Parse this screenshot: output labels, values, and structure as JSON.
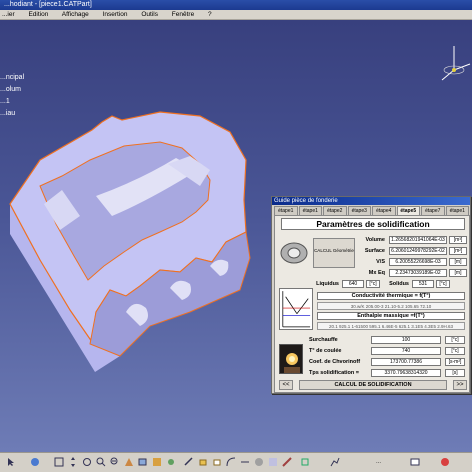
{
  "window": {
    "title": "...hodiant - [piece1.CATPart]"
  },
  "menu": [
    "...ier",
    "Edition",
    "Affichage",
    "Insertion",
    "Outils",
    "Fenêtre",
    "?"
  ],
  "tree": [
    "...ncipal",
    "...olum",
    "...1",
    "...iau"
  ],
  "dialog": {
    "title": "Guide pièce de fonderie",
    "tabs": [
      "étape1",
      "étape1",
      "étape2",
      "étape3",
      "étape4",
      "étape5",
      "étape7",
      "étape1"
    ],
    "active_tab": 5,
    "panel_title": "Paramètres de solidification",
    "calc_button": "CALCUL Géométrie",
    "fields": [
      {
        "label": "Volume",
        "value": "1.26568201941064E-03",
        "unit": "[m³]"
      },
      {
        "label": "Surface",
        "value": "6.20601249978292E-02",
        "unit": "[m²]"
      },
      {
        "label": "V/S",
        "value": "6.20055226698E-03",
        "unit": "[m]"
      },
      {
        "label": "Mx Eq",
        "value": "2.23473039189E-02",
        "unit": "[m]"
      }
    ],
    "liquidus": {
      "label": "Liquidus",
      "value": "640",
      "unit": "[°c]"
    },
    "solidus": {
      "label": "Solidus",
      "value": "531",
      "unit": "[°c]"
    },
    "conductivity": {
      "label": "Conductivité thermique = f(T°)",
      "values": "30.w/K  205.00-3  21.10-5.2  105.65  72.10"
    },
    "enthalpy": {
      "label": "Enthalpie massique =f(T°)",
      "values": "20.1  925.1 1-61500  595.1  6.46E-5  625.1  3.1E5  4.3E5  2.9H.63"
    },
    "params": [
      {
        "label": "Surchauffe",
        "value": "100",
        "unit": "[°c]"
      },
      {
        "label": "T° de coulée",
        "value": "740",
        "unit": "[°c]"
      },
      {
        "label": "Coef. de Chvorinoff",
        "value": "173700.77386",
        "unit": "[s-m²]"
      },
      {
        "label": "Tps solidification =",
        "value": "3370.79638314320",
        "unit": "[s]"
      }
    ],
    "nav_prev": "<<",
    "nav_next": ">>",
    "main_button": "CALCUL DE SOLIDIFICATION"
  },
  "statusbar_text": "..."
}
